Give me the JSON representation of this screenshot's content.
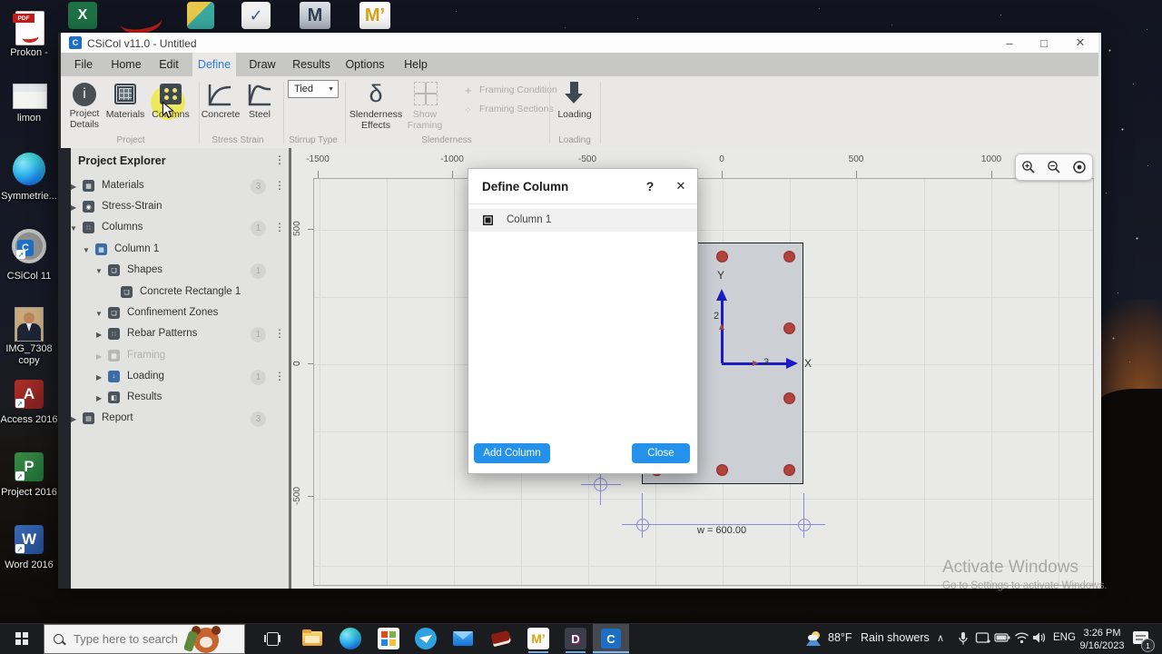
{
  "desktop": {
    "icons": [
      {
        "name": "pdf-prokon",
        "label": "Prokon -"
      },
      {
        "name": "limon-doc",
        "label": "limon"
      },
      {
        "name": "edge-shortcut",
        "label": "Symmetrie..."
      },
      {
        "name": "csicol-app",
        "label": "CSiCol 11"
      },
      {
        "name": "photo",
        "label": "IMG_7308 copy"
      },
      {
        "name": "access",
        "label": "Access 2016"
      },
      {
        "name": "project",
        "label": "Project 2016"
      },
      {
        "name": "word",
        "label": "Word 2016"
      }
    ],
    "top_icons": [
      "excel-icon",
      "prokon-swoosh-icon",
      "nitro-icon",
      "check-doc-icon",
      "m-dark-icon",
      "m-gold-icon"
    ]
  },
  "window": {
    "title": "CSiCol v11.0 - Untitled",
    "min": "–",
    "max": "□",
    "close": "✕"
  },
  "menu": {
    "items": [
      {
        "label": "File"
      },
      {
        "label": "Home"
      },
      {
        "label": "Edit"
      },
      {
        "label": "Define"
      },
      {
        "label": "Draw"
      },
      {
        "label": "Results"
      },
      {
        "label": "Options"
      },
      {
        "label": "Help"
      }
    ],
    "active": "Define"
  },
  "ribbon": {
    "buttons": {
      "project_details": "Project Details",
      "materials": "Materials",
      "columns": "Columns",
      "concrete": "Concrete",
      "steel": "Steel",
      "stirrup_value": "Tied",
      "slenderness_effects": "Slenderness Effects",
      "show_framing": "Show Framing",
      "framing_condition": "Framing Condition",
      "framing_sections": "Framing Sections",
      "loading": "Loading",
      "delta": "δ"
    },
    "groups": [
      {
        "label": "Project"
      },
      {
        "label": "Stress Strain"
      },
      {
        "label": "Stirrup Type"
      },
      {
        "label": "Slenderness"
      },
      {
        "label": "Loading"
      }
    ]
  },
  "explorer": {
    "title": "Project Explorer",
    "items": [
      {
        "label": "Materials",
        "badge": "3"
      },
      {
        "label": "Stress-Strain",
        "badge": ""
      },
      {
        "label": "Columns",
        "badge": "1"
      },
      {
        "label": "Column 1",
        "badge": ""
      },
      {
        "label": "Shapes",
        "badge": "1"
      },
      {
        "label": "Concrete Rectangle 1",
        "badge": ""
      },
      {
        "label": "Confinement Zones",
        "badge": ""
      },
      {
        "label": "Rebar Patterns",
        "badge": "1"
      },
      {
        "label": "Framing",
        "badge": ""
      },
      {
        "label": "Loading",
        "badge": "1"
      },
      {
        "label": "Results",
        "badge": ""
      },
      {
        "label": "Report",
        "badge": "3"
      }
    ]
  },
  "canvas": {
    "ruler_top": [
      {
        "v": "-1500"
      },
      {
        "v": "-1000"
      },
      {
        "v": "-500"
      },
      {
        "v": "0"
      },
      {
        "v": "500"
      },
      {
        "v": "1000"
      }
    ],
    "ruler_left": [
      {
        "v": "500"
      },
      {
        "v": "0"
      },
      {
        "v": "-500"
      }
    ],
    "axis": {
      "x": "X",
      "y": "Y",
      "a2": "2",
      "a3": "3"
    },
    "dimension": "w = 600.00"
  },
  "dialog": {
    "title": "Define Column",
    "help": "?",
    "close": "✕",
    "rows": [
      {
        "label": "Column 1"
      }
    ],
    "add_button": "Add Column",
    "close_button": "Close"
  },
  "watermark": {
    "line1": "Activate Windows",
    "line2": "Go to Settings to activate Windows."
  },
  "taskbar": {
    "search_placeholder": "Type here to search",
    "weather": {
      "temp": "88°F",
      "condition": "Rain showers"
    },
    "lang": "ENG",
    "time": "3:26 PM",
    "date": "9/16/2023",
    "badge": "1"
  }
}
